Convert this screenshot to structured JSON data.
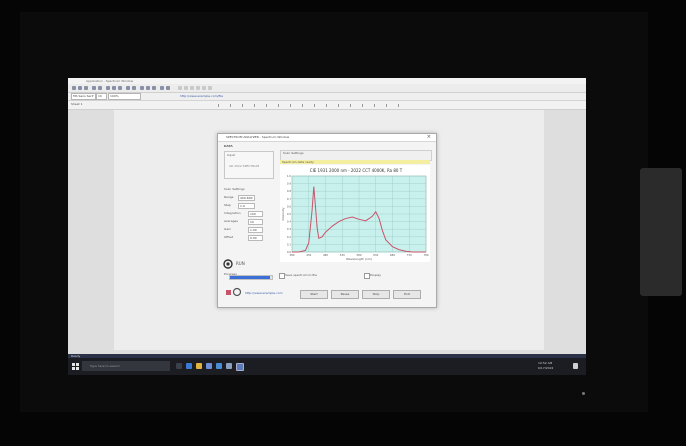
{
  "window": {
    "title": "Application - Spectrum Window",
    "menu": [
      "File",
      "Edit",
      "View",
      "Insert",
      "Format",
      "Tools",
      "Window",
      "Help"
    ]
  },
  "toolbar": {
    "font_name": "MS Sans Serif",
    "font_size": "10",
    "zoom": "100%",
    "link_text": "http://www.example.com/file",
    "tab": "Sheet 1"
  },
  "dialog": {
    "title": "SPECTRUM ANALYZER - Spectrum Window",
    "section_title": "DATA",
    "group_label": "Input",
    "group_value": "AR 2022 SPECTRUM",
    "scan_settings": "Scan Settings",
    "fields": [
      {
        "label": "Range",
        "value": "400-800"
      },
      {
        "label": "Step",
        "value": "1.0"
      },
      {
        "label": "Integration",
        "value": "100"
      },
      {
        "label": "Averages",
        "value": "10"
      },
      {
        "label": "Gain",
        "value": "1.00"
      },
      {
        "label": "Offset",
        "value": "0.00"
      }
    ],
    "run_label": "RUN",
    "progress_label": "Progress",
    "progress_value": 0.95,
    "options": [
      "Save spectrum to file",
      "Display"
    ],
    "link": "http://www.example.com",
    "buttons": [
      "Start",
      "Pause",
      "Stop",
      "Exit"
    ],
    "chart_header": "Scan Settings",
    "chart_title": "CIE 1931 2000 nm - 2022 CCT 4000K, Ra 80 T",
    "chart_hint": "Spectrum data ready"
  },
  "chart_data": {
    "type": "line",
    "title": "CIE 1931 2000 nm - 2022 CCT 4000K, Ra 80 T",
    "xlabel": "Wavelength (nm)",
    "ylabel": "Intensity",
    "xlim": [
      380,
      780
    ],
    "ylim": [
      0,
      1.0
    ],
    "grid": true,
    "series": [
      {
        "x": [
          380,
          400,
          420,
          430,
          440,
          445,
          450,
          455,
          460,
          470,
          480,
          490,
          500,
          520,
          540,
          560,
          580,
          600,
          620,
          630,
          640,
          650,
          660,
          680,
          700,
          720,
          740,
          760,
          780
        ],
        "y": [
          0.0,
          0.0,
          0.02,
          0.12,
          0.55,
          0.86,
          0.6,
          0.32,
          0.18,
          0.2,
          0.26,
          0.3,
          0.34,
          0.4,
          0.44,
          0.46,
          0.43,
          0.41,
          0.47,
          0.53,
          0.44,
          0.28,
          0.16,
          0.07,
          0.03,
          0.01,
          0.0,
          0.0,
          0.0
        ],
        "color": "#c9546a"
      }
    ]
  },
  "taskbar": {
    "search_placeholder": "Type here to search",
    "time": "10:52 AM",
    "date": "6/17/2022",
    "status_left": "Ready"
  },
  "colors": {
    "accent": "#3b6fd6",
    "plot_bg": "#c8f0ec",
    "curve": "#c9546a",
    "taskbar": "#1c1d22"
  }
}
